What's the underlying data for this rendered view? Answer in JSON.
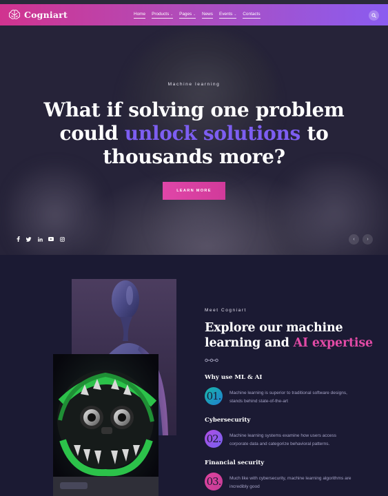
{
  "brand": {
    "name": "Cogniart"
  },
  "nav": {
    "items": [
      {
        "label": "Home",
        "dropdown": false
      },
      {
        "label": "Products",
        "dropdown": true
      },
      {
        "label": "Pages",
        "dropdown": true
      },
      {
        "label": "News",
        "dropdown": false
      },
      {
        "label": "Events",
        "dropdown": true
      },
      {
        "label": "Contacts",
        "dropdown": false
      }
    ],
    "search_icon": "search-icon"
  },
  "hero": {
    "eyebrow": "Machine learning",
    "headline_part1": "What if solving one problem could",
    "headline_accent": "unlock solutions",
    "headline_part2": "to thousands more?",
    "cta_label": "LEARN MORE",
    "socials": [
      "facebook-icon",
      "twitter-icon",
      "linkedin-icon",
      "youtube-icon",
      "instagram-icon"
    ],
    "prev_icon": "chevron-left-icon",
    "next_icon": "chevron-right-icon"
  },
  "about": {
    "eyebrow": "Meet Cogniart",
    "title_part1": "Explore our machine learning and",
    "title_accent": "AI expertise",
    "features": [
      {
        "number": "01.",
        "title": "Why use ML & AI",
        "description": "Machine learning is superior to traditional software designs, stands behind state-of-the-art",
        "gradient": [
          "#19b6a7",
          "#1f7fd1"
        ]
      },
      {
        "number": "02.",
        "title": "Cybersecurity",
        "description": "Machine learning systems examine how users access corporate data and categorize behavioral patterns.",
        "gradient": [
          "#b04de3",
          "#7562f0"
        ]
      },
      {
        "number": "03.",
        "title": "Financial security",
        "description": "Much like with cybersecurity, machine learning algorithms are incredibly good",
        "gradient": [
          "#e0449f",
          "#c43c96"
        ]
      }
    ]
  },
  "colors": {
    "header_gradient_start": "#d1338f",
    "header_gradient_end": "#8a5cf0",
    "accent_purple": "#7d5ef2",
    "accent_pink": "#e14aa5",
    "background": "#1b1a33"
  }
}
